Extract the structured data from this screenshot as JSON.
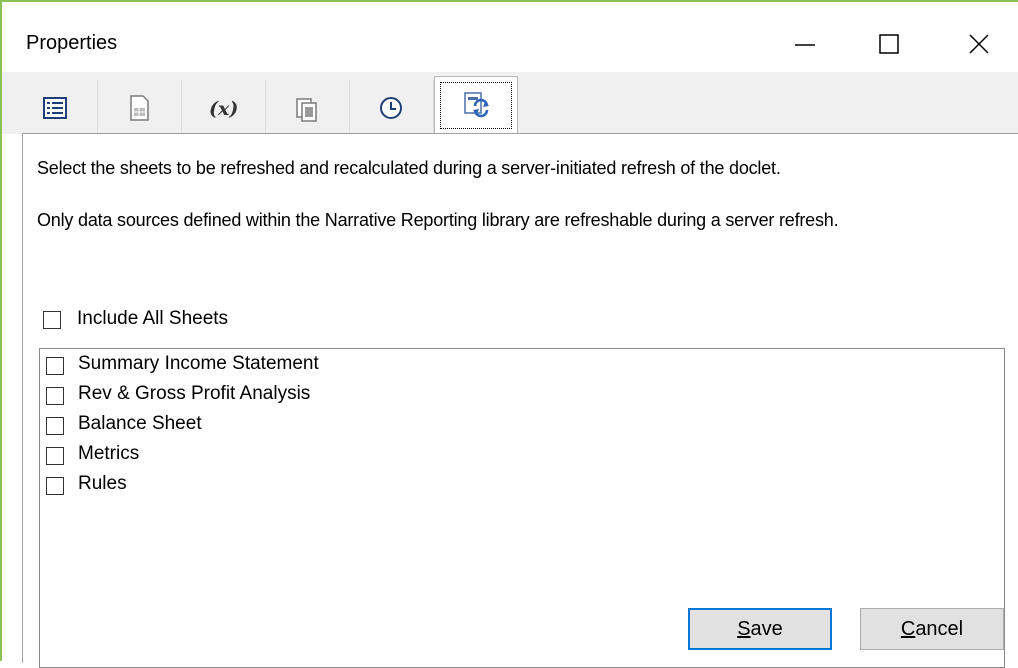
{
  "window": {
    "title": "Properties"
  },
  "title_controls": [
    {
      "name": "minimize",
      "icon": "minimize-icon"
    },
    {
      "name": "maximize",
      "icon": "maximize-icon"
    },
    {
      "name": "close",
      "icon": "close-icon"
    }
  ],
  "tabs": [
    {
      "icon": "list-properties-icon",
      "label": "",
      "glyph": ""
    },
    {
      "icon": "document-icon",
      "label": "",
      "glyph": ""
    },
    {
      "icon": "variables-icon",
      "label": "",
      "glyph": "(x)"
    },
    {
      "icon": "document-refresh-icon",
      "label": "",
      "glyph": ""
    },
    {
      "icon": "clock-icon",
      "label": "",
      "glyph": ""
    },
    {
      "icon": "server-refresh-icon",
      "label": "",
      "glyph": "",
      "active": true
    }
  ],
  "content": {
    "description1": "Select the sheets to be refreshed and recalculated during a server-initiated refresh of the doclet.",
    "description2": "Only data sources defined within the Narrative Reporting library are refreshable during a server refresh.",
    "include_all_label": "Include All Sheets",
    "include_all_checked": false,
    "sheets": [
      {
        "label": "Summary Income Statement",
        "checked": false
      },
      {
        "label": "Rev & Gross Profit Analysis",
        "checked": false
      },
      {
        "label": "Balance Sheet",
        "checked": false
      },
      {
        "label": "Metrics",
        "checked": false
      },
      {
        "label": "Rules",
        "checked": false
      }
    ]
  },
  "buttons": {
    "save_mnemonic": "S",
    "save_rest": "ave",
    "cancel_mnemonic": "C",
    "cancel_rest": "ancel"
  },
  "colors": {
    "accent_border": "#8cc152",
    "focus_blue": "#0078d7",
    "button_face": "#e1e1e1"
  }
}
